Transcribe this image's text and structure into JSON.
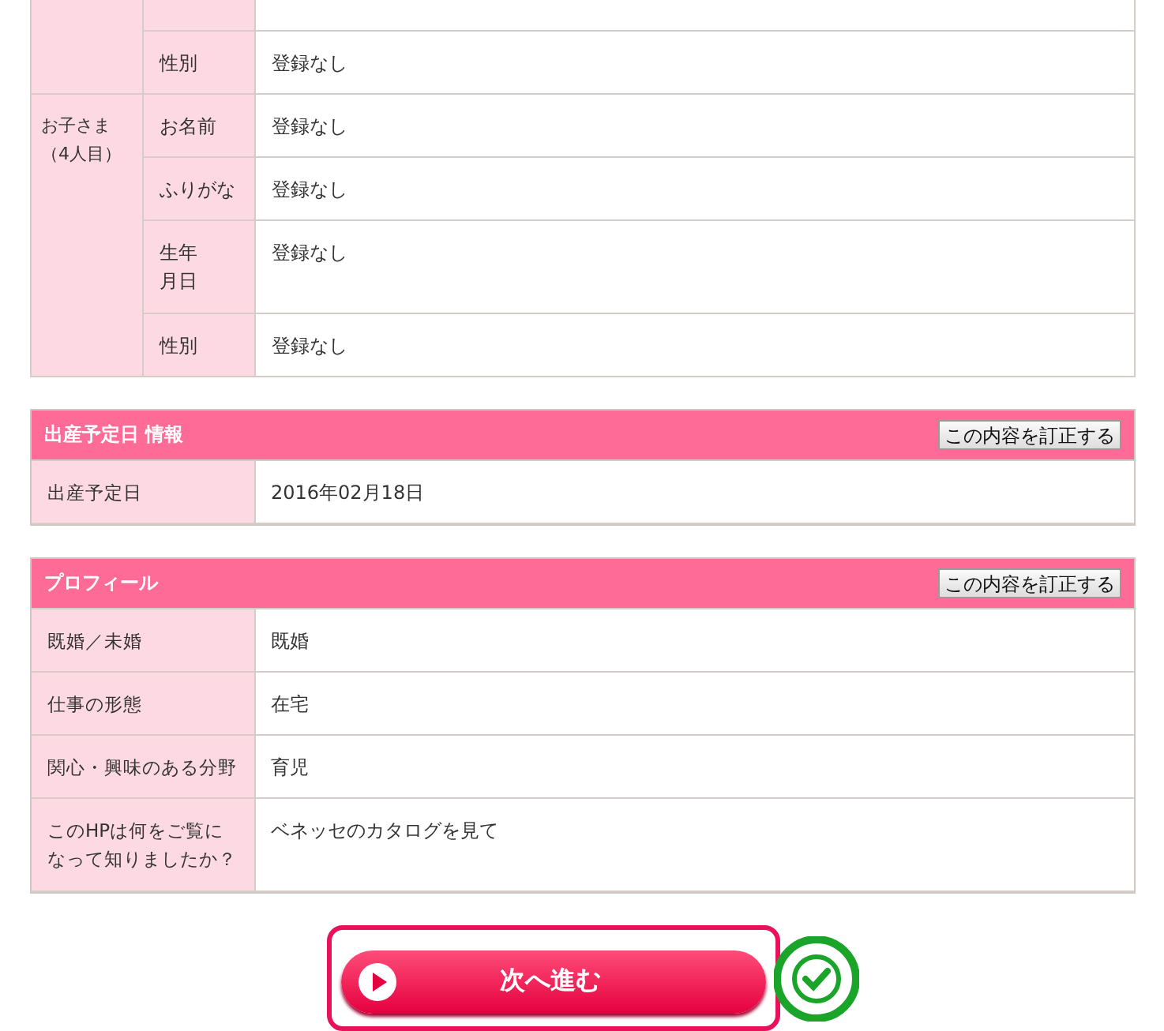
{
  "children_table": {
    "groups": [
      {
        "rows": [
          {
            "partial": true
          },
          {
            "label": "性別",
            "value": "登録なし"
          }
        ]
      },
      {
        "label": "お子さま（4人目）",
        "rows": [
          {
            "label": "お名前",
            "value": "登録なし"
          },
          {
            "label": "ふりがな",
            "value": "登録なし"
          },
          {
            "label": "生年月日",
            "value": "登録なし",
            "tall": true
          },
          {
            "label": "性別",
            "value": "登録なし"
          }
        ]
      }
    ]
  },
  "sections": [
    {
      "title": "出産予定日 情報",
      "button": "この内容を訂正する",
      "rows": [
        {
          "label": "出産予定日",
          "value": "2016年02月18日"
        }
      ]
    },
    {
      "title": "プロフィール",
      "button": "この内容を訂正する",
      "rows": [
        {
          "label": "既婚／未婚",
          "value": "既婚"
        },
        {
          "label": "仕事の形態",
          "value": "在宅"
        },
        {
          "label": "関心・興味のある分野",
          "value": "育児"
        },
        {
          "label": "このHPは何をご覧になって知りましたか？",
          "value": "ベネッセのカタログを見て",
          "tall": true
        }
      ]
    }
  ],
  "next_button": {
    "label": "次へ進む",
    "checked": true
  }
}
